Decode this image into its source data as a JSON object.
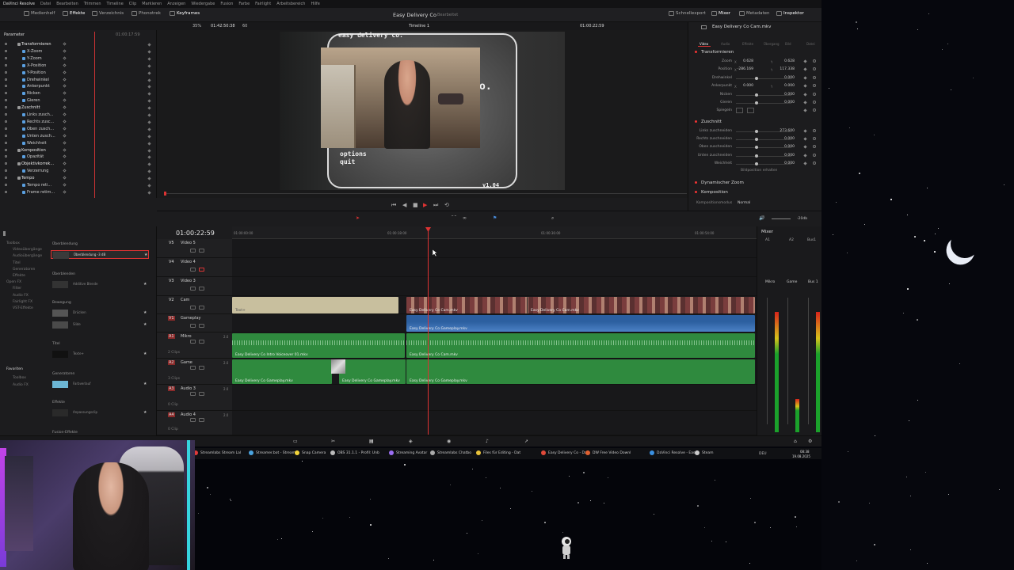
{
  "menu": [
    "DaVinci Resolve",
    "Datei",
    "Bearbeiten",
    "Trimmen",
    "Timeline",
    "Clip",
    "Markieren",
    "Anzeigen",
    "Wiedergabe",
    "Fusion",
    "Farbe",
    "Fairlight",
    "Arbeitsbereich",
    "Hilfe"
  ],
  "pagebar": {
    "left_tabs": [
      "Medienhelf",
      "Effekte",
      "Verzeichnis",
      "Phonotrek",
      "Keyframes"
    ],
    "project_title": "Easy Delivery Co",
    "project_status": "Bearbeitet",
    "right_tabs": [
      "Schnellexport",
      "Mixer",
      "Metadaten",
      "Inspektor"
    ]
  },
  "viewerbar": {
    "zoom": "35%",
    "source_tc": "01:42:50:38",
    "fps": "60",
    "timeline_name": "Timeline 1",
    "record_tc": "01:00:22:59"
  },
  "keyframes": {
    "header": "Parameter",
    "rows": [
      {
        "label": "Transformieren",
        "level": 0
      },
      {
        "label": "X-Zoom",
        "level": 1,
        "kf": true
      },
      {
        "label": "Y-Zoom",
        "level": 1
      },
      {
        "label": "X-Position",
        "level": 1
      },
      {
        "label": "Y-Position",
        "level": 1
      },
      {
        "label": "Drehwinkel",
        "level": 1
      },
      {
        "label": "Ankerpunkt",
        "level": 1
      },
      {
        "label": "Nicken",
        "level": 1
      },
      {
        "label": "Gieren",
        "level": 1
      },
      {
        "label": "Zuschnitt",
        "level": 0
      },
      {
        "label": "Links zusch...",
        "level": 1
      },
      {
        "label": "Rechts zusc...",
        "level": 1
      },
      {
        "label": "Oben zusch...",
        "level": 1
      },
      {
        "label": "Unten zusch...",
        "level": 1
      },
      {
        "label": "Weichheit",
        "level": 1
      },
      {
        "label": "Komposition",
        "level": 0
      },
      {
        "label": "Opazität",
        "level": 1
      },
      {
        "label": "Objektivkorrek...",
        "level": 0
      },
      {
        "label": "Verzerrung",
        "level": 1
      },
      {
        "label": "Tempo",
        "level": 0
      },
      {
        "label": "Tempo reti...",
        "level": 1
      },
      {
        "label": "Frame retim...",
        "level": 1
      }
    ],
    "ruler_tc": "01:00:17:59"
  },
  "game": {
    "title": "easy delivery co.",
    "menu_options": "options",
    "menu_quit": "quit",
    "version": "v1.04",
    "letter": "o."
  },
  "inspector": {
    "clip_name": "Easy Delivery Co Cam.mkv",
    "tabs": [
      "Video",
      "Audio",
      "Effekte",
      "Übergang",
      "Bild",
      "Datei"
    ],
    "sections": {
      "transform": "Transformieren",
      "crop": "Zuschnitt",
      "dynzoom": "Dynamischer Zoom",
      "composite": "Komposition"
    },
    "transform_rows": [
      {
        "label": "Zoom",
        "x": "0.628",
        "y": "0.628"
      },
      {
        "label": "Position",
        "x": "-286.169",
        "y": "117.338"
      },
      {
        "label": "Drehwinkel",
        "v": "0.000"
      },
      {
        "label": "Ankerpunkt",
        "x": "0.000",
        "y": "0.000"
      },
      {
        "label": "Nicken",
        "v": "0.000"
      },
      {
        "label": "Gieren",
        "v": "0.000"
      },
      {
        "label": "Spiegeln",
        "v": ""
      }
    ],
    "crop_rows": [
      {
        "label": "Links zuschneiden",
        "v": "273.600"
      },
      {
        "label": "Rechts zuschneiden",
        "v": "0.000"
      },
      {
        "label": "Oben zuschneiden",
        "v": "0.000"
      },
      {
        "label": "Unten zuschneiden",
        "v": "0.000"
      },
      {
        "label": "Weichheit",
        "v": "0.000"
      }
    ],
    "keep_position": "Bildposition erhalten",
    "composite_mode_label": "Kompositionsmodus",
    "composite_mode_value": "Normal"
  },
  "effects": {
    "tree": [
      "Toolbox",
      "Videoübergänge",
      "Audioübergänge",
      "Titel",
      "Generatoren",
      "Effekte",
      "Open FX",
      "Filter",
      "Audio FX",
      "Fairlight FX",
      "VST-Effekte"
    ],
    "favorites_header": "Favoriten",
    "favorites": [
      "Toolbox",
      "Audio FX"
    ],
    "groups": [
      {
        "header": "Überblendung",
        "items": [
          {
            "label": "Überblendung -3 dB",
            "selected": true,
            "color": "#3a3a3a"
          }
        ]
      },
      {
        "header": "Überblenden",
        "items": [
          {
            "label": "Additive Blende",
            "color": "#333"
          }
        ]
      },
      {
        "header": "Bewegung",
        "items": [
          {
            "label": "Drücken",
            "color": "#555"
          },
          {
            "label": "Slide",
            "color": "#4a4a4a"
          }
        ]
      },
      {
        "header": "Titel",
        "items": [
          {
            "label": "Texte+",
            "color": "#111"
          }
        ]
      },
      {
        "header": "Generatoren",
        "items": [
          {
            "label": "Farbverlauf",
            "color": "#6cb6d4"
          }
        ]
      },
      {
        "header": "Effekte",
        "items": [
          {
            "label": "Anpassungsclip",
            "color": "#2a2a2a"
          }
        ]
      },
      {
        "header": "Fusion-Effekte",
        "items": []
      }
    ]
  },
  "timeline": {
    "timecode": "01:00:22:59",
    "ruler": [
      "01:00:00:00",
      "01:00:18:00",
      "01:00:36:00",
      "01:00:54:00"
    ],
    "tracks": [
      {
        "id": "V5",
        "name": "Video 5",
        "kind": "video",
        "h": 24
      },
      {
        "id": "V4",
        "name": "Video 4",
        "kind": "video",
        "h": 24
      },
      {
        "id": "V3",
        "name": "Video 3",
        "kind": "video",
        "h": 24
      },
      {
        "id": "V2",
        "name": "Cam",
        "kind": "video",
        "h": 23
      },
      {
        "id": "V1",
        "name": "Gameplay",
        "kind": "video",
        "h": 23
      },
      {
        "id": "A1",
        "name": "Mikro",
        "kind": "audio",
        "h": 33,
        "level": "2.0",
        "clips": "2 Clips"
      },
      {
        "id": "A2",
        "name": "Game",
        "kind": "audio",
        "h": 33,
        "level": "2.0",
        "clips": "3 Clips"
      },
      {
        "id": "A3",
        "name": "Audio 3",
        "kind": "audio",
        "h": 33,
        "level": "2.0",
        "clips": "0 Clip"
      },
      {
        "id": "A4",
        "name": "Audio 4",
        "kind": "audio",
        "h": 31,
        "level": "2.0",
        "clips": "0 Clip"
      }
    ],
    "clips": {
      "title_clip": "Text+",
      "cam1": "Easy Delivery Co Cam.mkv",
      "cam2": "Easy Delivery Co Cam.mkv",
      "game1": "Easy Delivery Co Gameplay.mkv",
      "mic1": "Easy Delivery Co Intro Voiceover 01.mkv",
      "mic2": "Easy Delivery Co Cam.mkv",
      "ga1": "Easy Delivery Co Gameplay.mkv",
      "ga2": "Easy Delivery Co Gameplay.mkv",
      "ga3": "Easy Delivery Co Gameplay.mkv"
    },
    "audio_dbs": "-20db"
  },
  "mixer": {
    "title": "Mixer",
    "channels": [
      "A1",
      "A2",
      "Bus1"
    ],
    "labels": [
      "Mikro",
      "Game",
      "Bus 1"
    ]
  },
  "taskbar": {
    "items": [
      {
        "label": "Streamlabs Stream Lal",
        "color": "#e03a3a"
      },
      {
        "label": "Streamer.bot - Stream",
        "color": "#4aa3df"
      },
      {
        "label": "Snap Camera",
        "color": "#f2d43a"
      },
      {
        "label": "OBS 31.1.1 - Profil: Unb",
        "color": "#bbbbbb"
      },
      {
        "label": "Streaming Avatar",
        "color": "#9b6ef2"
      },
      {
        "label": "Streamlabs Chatbo",
        "color": "#aaaaaa"
      },
      {
        "label": "Files für Editing - Dat",
        "color": "#e8c23a"
      },
      {
        "label": "Easy Delivery Co - Da",
        "color": "#e04a3a"
      },
      {
        "label": "DW Free Video Downl",
        "color": "#e06030"
      },
      {
        "label": "DaVinci Resolve - Eas",
        "color": "#3a8fe0"
      },
      {
        "label": "Steam",
        "color": "#cccccc"
      }
    ],
    "lang": "DEU",
    "time": "08:38",
    "date": "19.08.2025"
  }
}
